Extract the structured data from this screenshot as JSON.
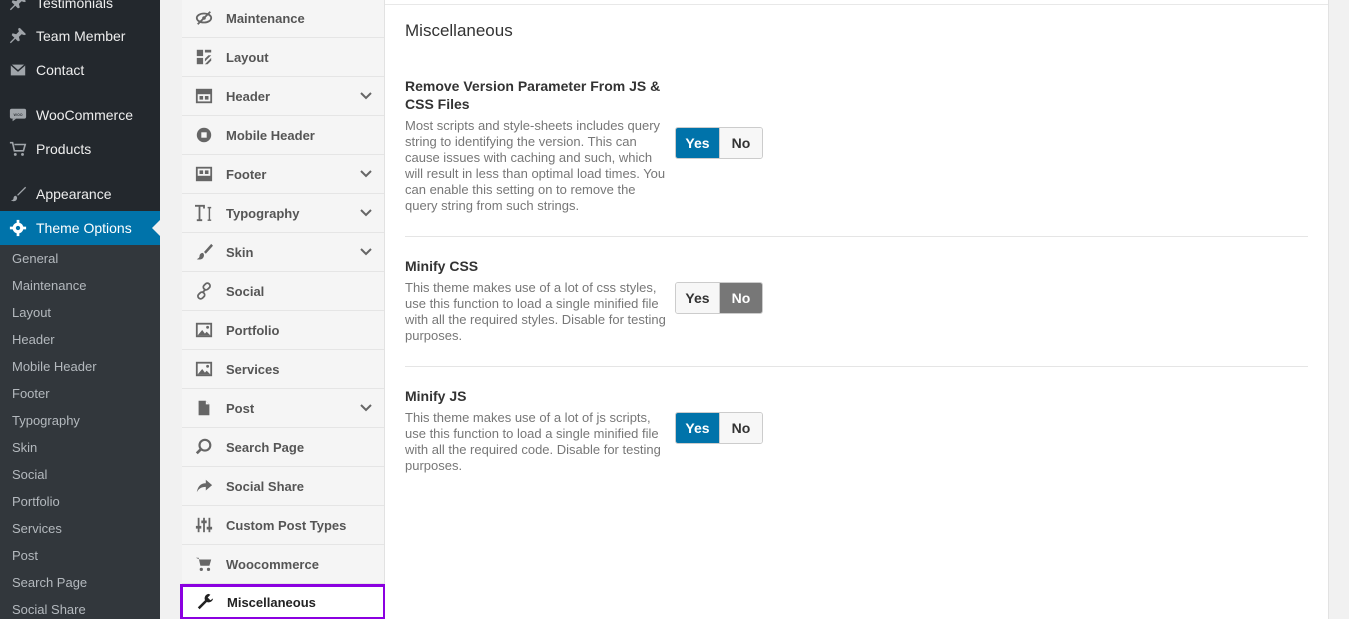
{
  "wp_menu": {
    "items": [
      {
        "label": "Testimonials",
        "icon": "pin-icon"
      },
      {
        "label": "Team Member",
        "icon": "pin-icon"
      },
      {
        "label": "Contact",
        "icon": "mail-icon"
      },
      {
        "label": "WooCommerce",
        "icon": "woo-icon"
      },
      {
        "label": "Products",
        "icon": "cart-icon"
      },
      {
        "label": "Appearance",
        "icon": "brush-icon"
      },
      {
        "label": "Theme Options",
        "icon": "gear-icon"
      }
    ],
    "submenu": [
      "General",
      "Maintenance",
      "Layout",
      "Header",
      "Mobile Header",
      "Footer",
      "Typography",
      "Skin",
      "Social",
      "Portfolio",
      "Services",
      "Post",
      "Search Page",
      "Social Share"
    ]
  },
  "options_nav": {
    "items": [
      {
        "label": "Maintenance",
        "icon": "eye-slash-icon",
        "has_children": false
      },
      {
        "label": "Layout",
        "icon": "layout-icon",
        "has_children": false
      },
      {
        "label": "Header",
        "icon": "header-icon",
        "has_children": true
      },
      {
        "label": "Mobile Header",
        "icon": "mobile-icon",
        "has_children": false
      },
      {
        "label": "Footer",
        "icon": "footer-icon",
        "has_children": true
      },
      {
        "label": "Typography",
        "icon": "typography-icon",
        "has_children": true
      },
      {
        "label": "Skin",
        "icon": "brush-icon",
        "has_children": true
      },
      {
        "label": "Social",
        "icon": "link-icon",
        "has_children": false
      },
      {
        "label": "Portfolio",
        "icon": "image-icon",
        "has_children": false
      },
      {
        "label": "Services",
        "icon": "image-icon",
        "has_children": false
      },
      {
        "label": "Post",
        "icon": "document-icon",
        "has_children": true
      },
      {
        "label": "Search Page",
        "icon": "search-icon",
        "has_children": false
      },
      {
        "label": "Social Share",
        "icon": "share-icon",
        "has_children": false
      },
      {
        "label": "Custom Post Types",
        "icon": "sliders-icon",
        "has_children": false
      },
      {
        "label": "Woocommerce",
        "icon": "cart-icon",
        "has_children": false
      },
      {
        "label": "Miscellaneous",
        "icon": "wrench-icon",
        "has_children": false
      }
    ],
    "active": "Miscellaneous"
  },
  "panel": {
    "title": "Miscellaneous",
    "settings": [
      {
        "title": "Remove Version Parameter From JS & CSS Files",
        "description": "Most scripts and style-sheets includes query string to identifying the version. This can cause issues with caching and such, which will result in less than optimal load times. You can enable this setting on to remove the query string from such strings.",
        "yes_label": "Yes",
        "no_label": "No",
        "value": "Yes"
      },
      {
        "title": "Minify CSS",
        "description": "This theme makes use of a lot of css styles, use this function to load a single minified file with all the required styles. Disable for testing purposes.",
        "yes_label": "Yes",
        "no_label": "No",
        "value": "No"
      },
      {
        "title": "Minify JS",
        "description": "This theme makes use of a lot of js scripts, use this function to load a single minified file with all the required code. Disable for testing purposes.",
        "yes_label": "Yes",
        "no_label": "No",
        "value": "Yes"
      }
    ]
  },
  "colors": {
    "wp_sidebar": "#23282d",
    "wp_current": "#0073aa",
    "toggle_yes_selected": "#0073aa",
    "toggle_no_selected": "#777777",
    "active_highlight": "#8b00e0"
  }
}
